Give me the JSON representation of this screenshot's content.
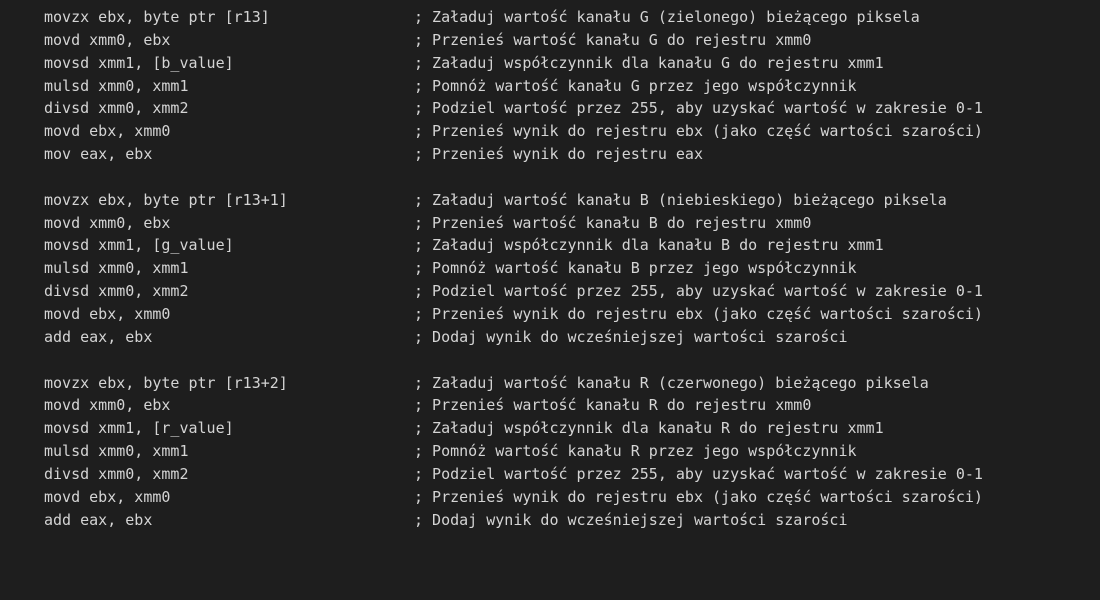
{
  "editor": {
    "blocks": [
      {
        "lines": [
          {
            "instruction": "movzx ebx, byte ptr [r13]",
            "comment": "; Załaduj wartość kanału G (zielonego) bieżącego piksela"
          },
          {
            "instruction": "movd xmm0, ebx",
            "comment": "; Przenieś wartość kanału G do rejestru xmm0"
          },
          {
            "instruction": "movsd xmm1, [b_value]",
            "comment": "; Załaduj współczynnik dla kanału G do rejestru xmm1"
          },
          {
            "instruction": "mulsd xmm0, xmm1",
            "comment": "; Pomnóż wartość kanału G przez jego współczynnik"
          },
          {
            "instruction": "divsd xmm0, xmm2",
            "comment": "; Podziel wartość przez 255, aby uzyskać wartość w zakresie 0-1"
          },
          {
            "instruction": "movd ebx, xmm0",
            "comment": "; Przenieś wynik do rejestru ebx (jako część wartości szarości)"
          },
          {
            "instruction": "mov eax, ebx",
            "comment": "; Przenieś wynik do rejestru eax"
          }
        ]
      },
      {
        "lines": [
          {
            "instruction": "movzx ebx, byte ptr [r13+1]",
            "comment": "; Załaduj wartość kanału B (niebieskiego) bieżącego piksela"
          },
          {
            "instruction": "movd xmm0, ebx",
            "comment": "; Przenieś wartość kanału B do rejestru xmm0"
          },
          {
            "instruction": "movsd xmm1, [g_value]",
            "comment": "; Załaduj współczynnik dla kanału B do rejestru xmm1"
          },
          {
            "instruction": "mulsd xmm0, xmm1",
            "comment": "; Pomnóż wartość kanału B przez jego współczynnik"
          },
          {
            "instruction": "divsd xmm0, xmm2",
            "comment": "; Podziel wartość przez 255, aby uzyskać wartość w zakresie 0-1"
          },
          {
            "instruction": "movd ebx, xmm0",
            "comment": "; Przenieś wynik do rejestru ebx (jako część wartości szarości)"
          },
          {
            "instruction": "add eax, ebx",
            "comment": "; Dodaj wynik do wcześniejszej wartości szarości"
          }
        ]
      },
      {
        "lines": [
          {
            "instruction": "movzx ebx, byte ptr [r13+2]",
            "comment": "; Załaduj wartość kanału R (czerwonego) bieżącego piksela"
          },
          {
            "instruction": "movd xmm0, ebx",
            "comment": "; Przenieś wartość kanału R do rejestru xmm0"
          },
          {
            "instruction": "movsd xmm1, [r_value]",
            "comment": "; Załaduj współczynnik dla kanału R do rejestru xmm1"
          },
          {
            "instruction": "mulsd xmm0, xmm1",
            "comment": "; Pomnóż wartość kanału R przez jego współczynnik"
          },
          {
            "instruction": "divsd xmm0, xmm2",
            "comment": "; Podziel wartość przez 255, aby uzyskać wartość w zakresie 0-1"
          },
          {
            "instruction": "movd ebx, xmm0",
            "comment": "; Przenieś wynik do rejestru ebx (jako część wartości szarości)"
          },
          {
            "instruction": "add eax, ebx",
            "comment": "; Dodaj wynik do wcześniejszej wartości szarości"
          }
        ]
      }
    ],
    "colors": {
      "background": "#1e1e1e",
      "text": "#d4d4d4"
    }
  }
}
